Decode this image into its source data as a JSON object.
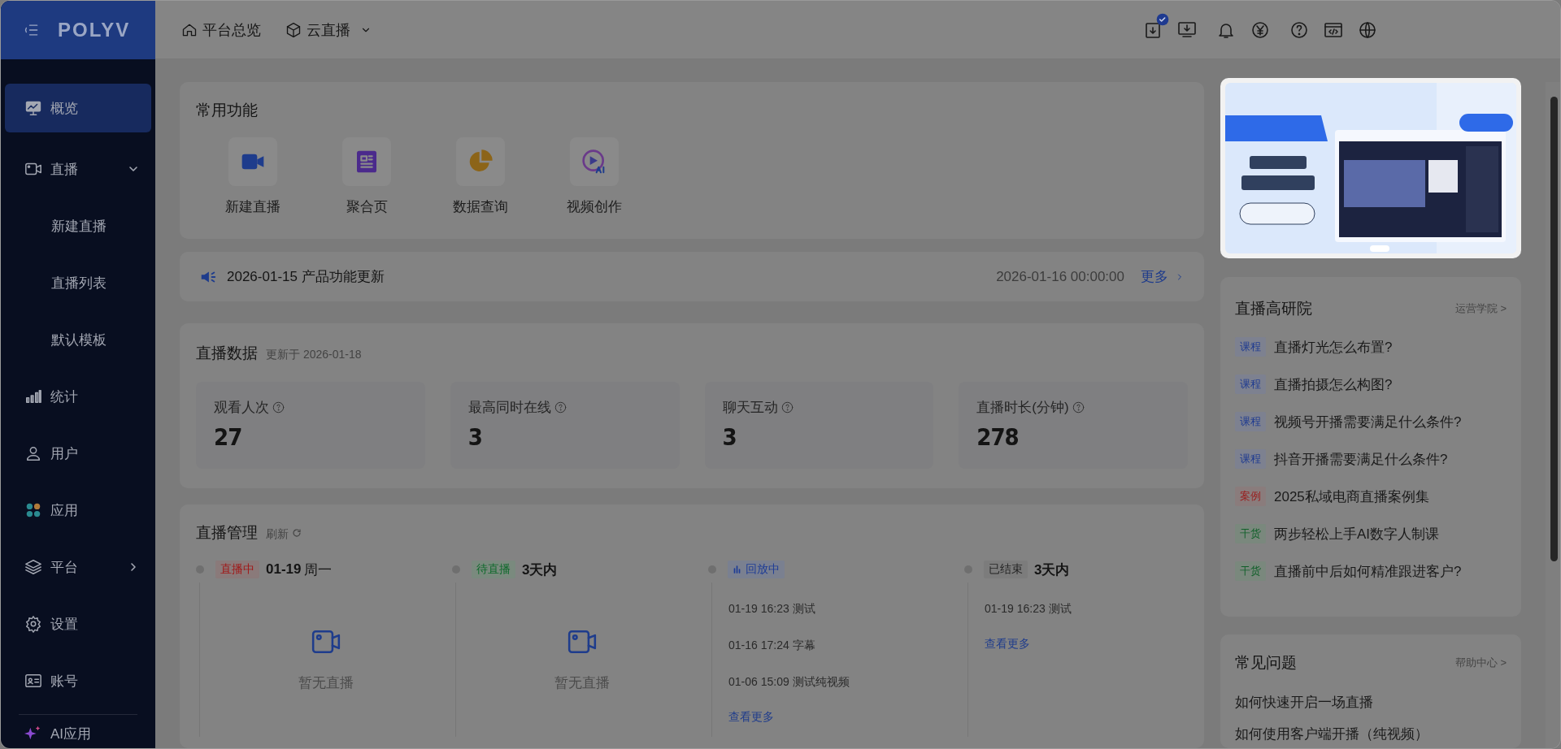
{
  "sidebar": {
    "logo": "POLYV",
    "items": [
      {
        "label": "概览",
        "kind": "link",
        "selected": true
      },
      {
        "label": "直播",
        "kind": "group",
        "selected": false,
        "expanded": true,
        "children": [
          {
            "label": "新建直播",
            "selected": false
          },
          {
            "label": "直播列表",
            "selected": false
          },
          {
            "label": "默认模板",
            "selected": false
          }
        ]
      },
      {
        "label": "统计",
        "kind": "link",
        "selected": false
      },
      {
        "label": "用户",
        "kind": "link",
        "selected": false
      },
      {
        "label": "应用",
        "kind": "link",
        "selected": false
      },
      {
        "label": "平台",
        "kind": "group",
        "selected": false,
        "expanded": false
      },
      {
        "label": "设置",
        "kind": "link",
        "selected": false
      },
      {
        "label": "账号",
        "kind": "link",
        "selected": false
      },
      {
        "label": "AI应用",
        "kind": "ai",
        "selected": false
      }
    ]
  },
  "header": {
    "nav": [
      {
        "label": "平台总览",
        "dropdown": false
      },
      {
        "label": "云直播",
        "dropdown": true
      }
    ]
  },
  "quick_functions": {
    "title": "常用功能",
    "items": [
      {
        "label": "新建直播"
      },
      {
        "label": "聚合页"
      },
      {
        "label": "数据查询"
      },
      {
        "label": "视频创作"
      }
    ]
  },
  "notice": {
    "text": "2026-01-15 产品功能更新",
    "time": "2026-01-16 00:00:00",
    "more": "更多"
  },
  "live_data": {
    "title": "直播数据",
    "updated": "更新于 2026-01-18",
    "stats": [
      {
        "label": "观看人次",
        "value": "27"
      },
      {
        "label": "最高同时在线",
        "value": "3"
      },
      {
        "label": "聊天互动",
        "value": "3"
      },
      {
        "label": "直播时长(分钟)",
        "value": "278"
      }
    ]
  },
  "live_management": {
    "title": "直播管理",
    "refresh": "刷新",
    "columns": [
      {
        "kind": "live",
        "status": "直播中",
        "date": "01-19",
        "weekday": "周一",
        "empty": "暂无直播"
      },
      {
        "kind": "upcoming",
        "status": "待直播",
        "date": "3天内",
        "empty": "暂无直播"
      },
      {
        "kind": "replay",
        "status": "回放中",
        "entries": [
          "01-19 16:23 测试",
          "01-16 17:24 字幕",
          "01-06 15:09 测试纯视频"
        ],
        "more": "查看更多"
      },
      {
        "kind": "ended",
        "status": "已结束",
        "date": "3天内",
        "entries": [
          "01-19 16:23 测试"
        ],
        "more": "查看更多"
      }
    ]
  },
  "academy": {
    "title": "直播高研院",
    "link": "运营学院 >",
    "items": [
      {
        "kind": "course",
        "tag": "课程",
        "text": "直播灯光怎么布置?"
      },
      {
        "kind": "course",
        "tag": "课程",
        "text": "直播拍摄怎么构图?"
      },
      {
        "kind": "course",
        "tag": "课程",
        "text": "视频号开播需要满足什么条件?"
      },
      {
        "kind": "course",
        "tag": "课程",
        "text": "抖音开播需要满足什么条件?"
      },
      {
        "kind": "case",
        "tag": "案例",
        "text": "2025私域电商直播案例集"
      },
      {
        "kind": "tips",
        "tag": "干货",
        "text": "两步轻松上手AI数字人制课"
      },
      {
        "kind": "tips",
        "tag": "干货",
        "text": "直播前中后如何精准跟进客户?"
      }
    ]
  },
  "faq": {
    "title": "常见问题",
    "link": "帮助中心 >",
    "items": [
      "如何快速开启一场直播",
      "如何使用客户端开播（纯视频）"
    ]
  }
}
